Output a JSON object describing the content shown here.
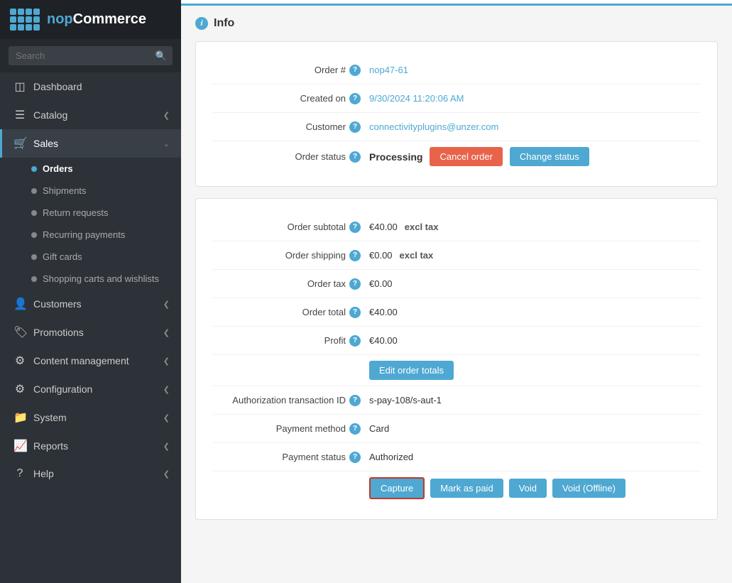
{
  "logo": {
    "text_nop": "nop",
    "text_commerce": "Commerce"
  },
  "search": {
    "placeholder": "Search"
  },
  "nav": {
    "dashboard": "Dashboard",
    "catalog": "Catalog",
    "sales": "Sales",
    "orders": "Orders",
    "shipments": "Shipments",
    "return_requests": "Return requests",
    "recurring_payments": "Recurring payments",
    "gift_cards": "Gift cards",
    "shopping_carts": "Shopping carts and wishlists",
    "customers": "Customers",
    "promotions": "Promotions",
    "content_management": "Content management",
    "configuration": "Configuration",
    "system": "System",
    "reports": "Reports",
    "help": "Help"
  },
  "page": {
    "section_title": "Info",
    "order_number_label": "Order #",
    "order_number_value": "nop47-61",
    "created_on_label": "Created on",
    "created_on_value": "9/30/2024 11:20:06 AM",
    "customer_label": "Customer",
    "customer_value": "connectivityplugins@unzer.com",
    "order_status_label": "Order status",
    "order_status_value": "Processing",
    "cancel_order_btn": "Cancel order",
    "change_status_btn": "Change status",
    "order_subtotal_label": "Order subtotal",
    "order_subtotal_value": "€40.00",
    "order_subtotal_tax": "excl tax",
    "order_shipping_label": "Order shipping",
    "order_shipping_value": "€0.00",
    "order_shipping_tax": "excl tax",
    "order_tax_label": "Order tax",
    "order_tax_value": "€0.00",
    "order_total_label": "Order total",
    "order_total_value": "€40.00",
    "profit_label": "Profit",
    "profit_value": "€40.00",
    "edit_order_totals_btn": "Edit order totals",
    "auth_transaction_label": "Authorization transaction ID",
    "auth_transaction_value": "s-pay-108/s-aut-1",
    "payment_method_label": "Payment method",
    "payment_method_value": "Card",
    "payment_status_label": "Payment status",
    "payment_status_value": "Authorized",
    "capture_btn": "Capture",
    "mark_as_paid_btn": "Mark as paid",
    "void_btn": "Void",
    "void_offline_btn": "Void (Offline)"
  }
}
